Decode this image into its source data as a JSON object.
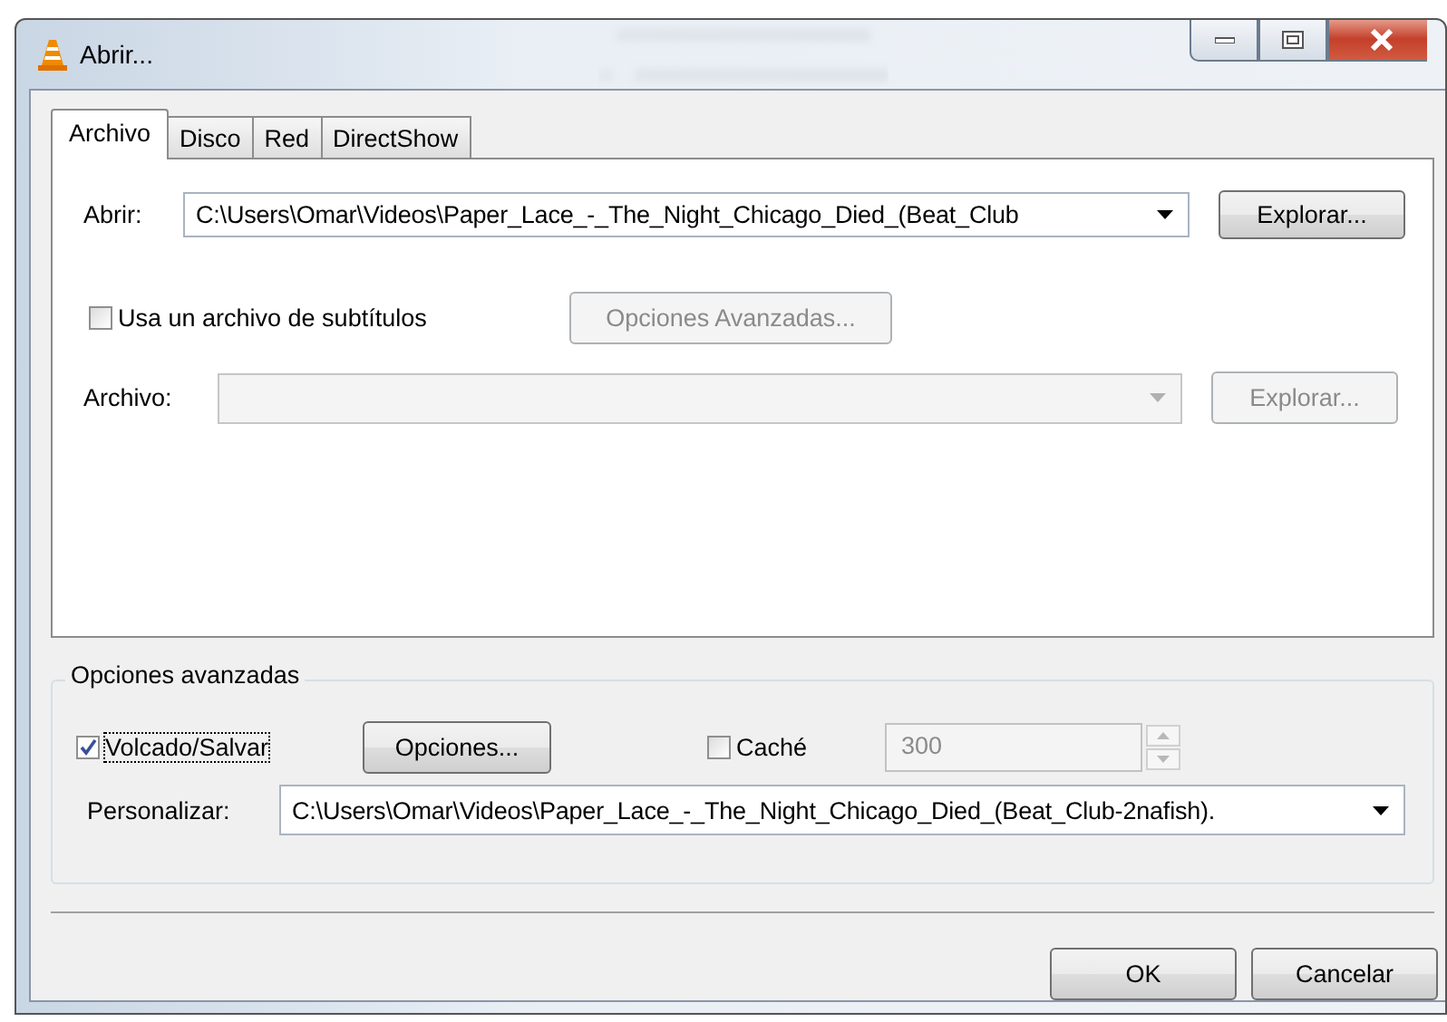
{
  "window": {
    "title": "Abrir..."
  },
  "tabs": [
    {
      "label": "Archivo",
      "selected": true
    },
    {
      "label": "Disco",
      "selected": false
    },
    {
      "label": "Red",
      "selected": false
    },
    {
      "label": "DirectShow",
      "selected": false
    }
  ],
  "open": {
    "label": "Abrir:",
    "value": "C:\\Users\\Omar\\Videos\\Paper_Lace_-_The_Night_Chicago_Died_(Beat_Club",
    "button": "Explorar..."
  },
  "subtitles": {
    "label": "Usa un archivo de subtítulos",
    "checked": false,
    "button": "Opciones Avanzadas...",
    "file_label": "Archivo:",
    "file_button": "Explorar...",
    "disabled": true
  },
  "advanced": {
    "title": "Opciones avanzadas",
    "dump": {
      "label": "Volcado/Salvar",
      "checked": true
    },
    "options_button": "Opciones...",
    "cache": {
      "label": "Caché",
      "checked": false,
      "value": "300",
      "disabled": true
    },
    "customize": {
      "label": "Personalizar:",
      "value": "C:\\Users\\Omar\\Videos\\Paper_Lace_-_The_Night_Chicago_Died_(Beat_Club-2nafish)."
    }
  },
  "buttons": [
    {
      "label": "OK"
    },
    {
      "label": "Cancelar"
    }
  ]
}
